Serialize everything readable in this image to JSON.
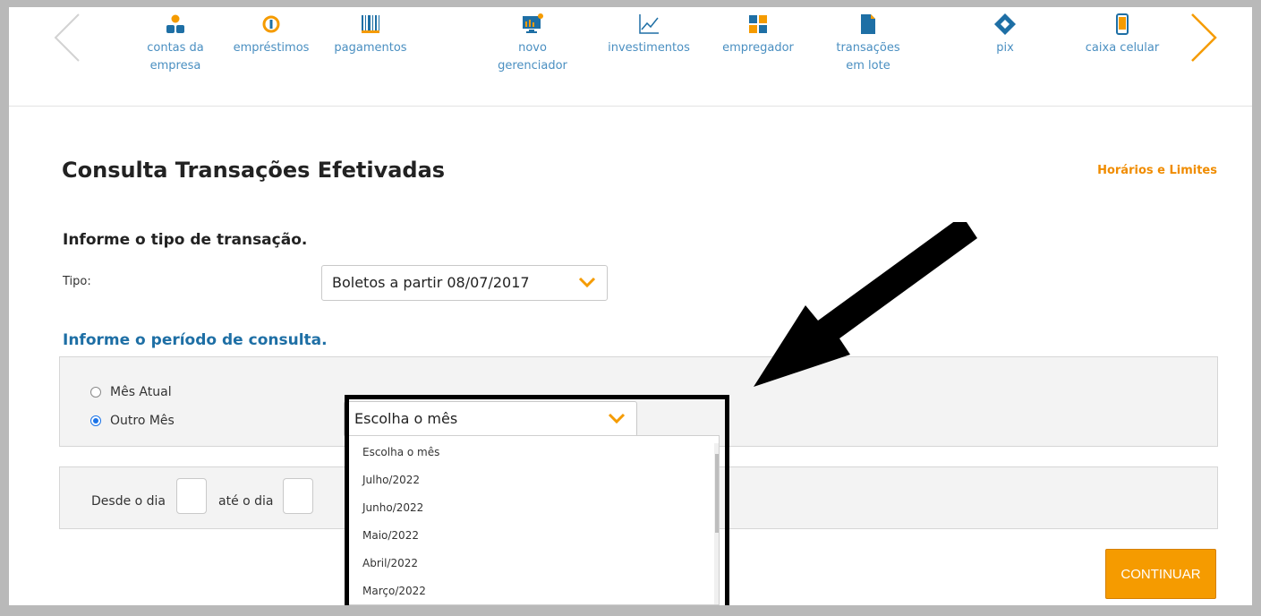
{
  "nav": {
    "items": [
      {
        "label": "contas da\nempresa",
        "icon": "people-icon"
      },
      {
        "label": "empréstimos",
        "icon": "coin-icon"
      },
      {
        "label": "pagamentos",
        "icon": "barcode-icon"
      },
      {
        "label": "novo\ngerenciador",
        "icon": "monitor-chart-icon"
      },
      {
        "label": "investimentos",
        "icon": "line-chart-icon"
      },
      {
        "label": "empregador",
        "icon": "puzzle-icon"
      },
      {
        "label": "transações\nem lote",
        "icon": "document-icon"
      },
      {
        "label": "pix",
        "icon": "pix-icon"
      },
      {
        "label": "caixa celular",
        "icon": "phone-icon"
      }
    ]
  },
  "page": {
    "title": "Consulta Transações Efetivadas",
    "help_link": "Horários e Limites"
  },
  "transaction": {
    "heading": "Informe o tipo de transação.",
    "type_label": "Tipo:",
    "type_value": "Boletos a partir 08/07/2017"
  },
  "period": {
    "heading": "Informe o período de consulta.",
    "option_current": "Mês Atual",
    "option_other": "Outro Mês",
    "selected_option": "Outro Mês",
    "month_select_value": "Escolha o mês",
    "month_options": [
      "Escolha o mês",
      "Julho/2022",
      "Junho/2022",
      "Maio/2022",
      "Abril/2022",
      "Março/2022"
    ]
  },
  "days": {
    "from_label": "Desde o dia",
    "to_label": "até o dia",
    "from_value": "",
    "to_value": ""
  },
  "actions": {
    "continue_label": "CONTINUAR"
  },
  "colors": {
    "accent_orange": "#f59b00",
    "link_blue": "#4a8fc1",
    "heading_blue": "#1e6fa5"
  }
}
